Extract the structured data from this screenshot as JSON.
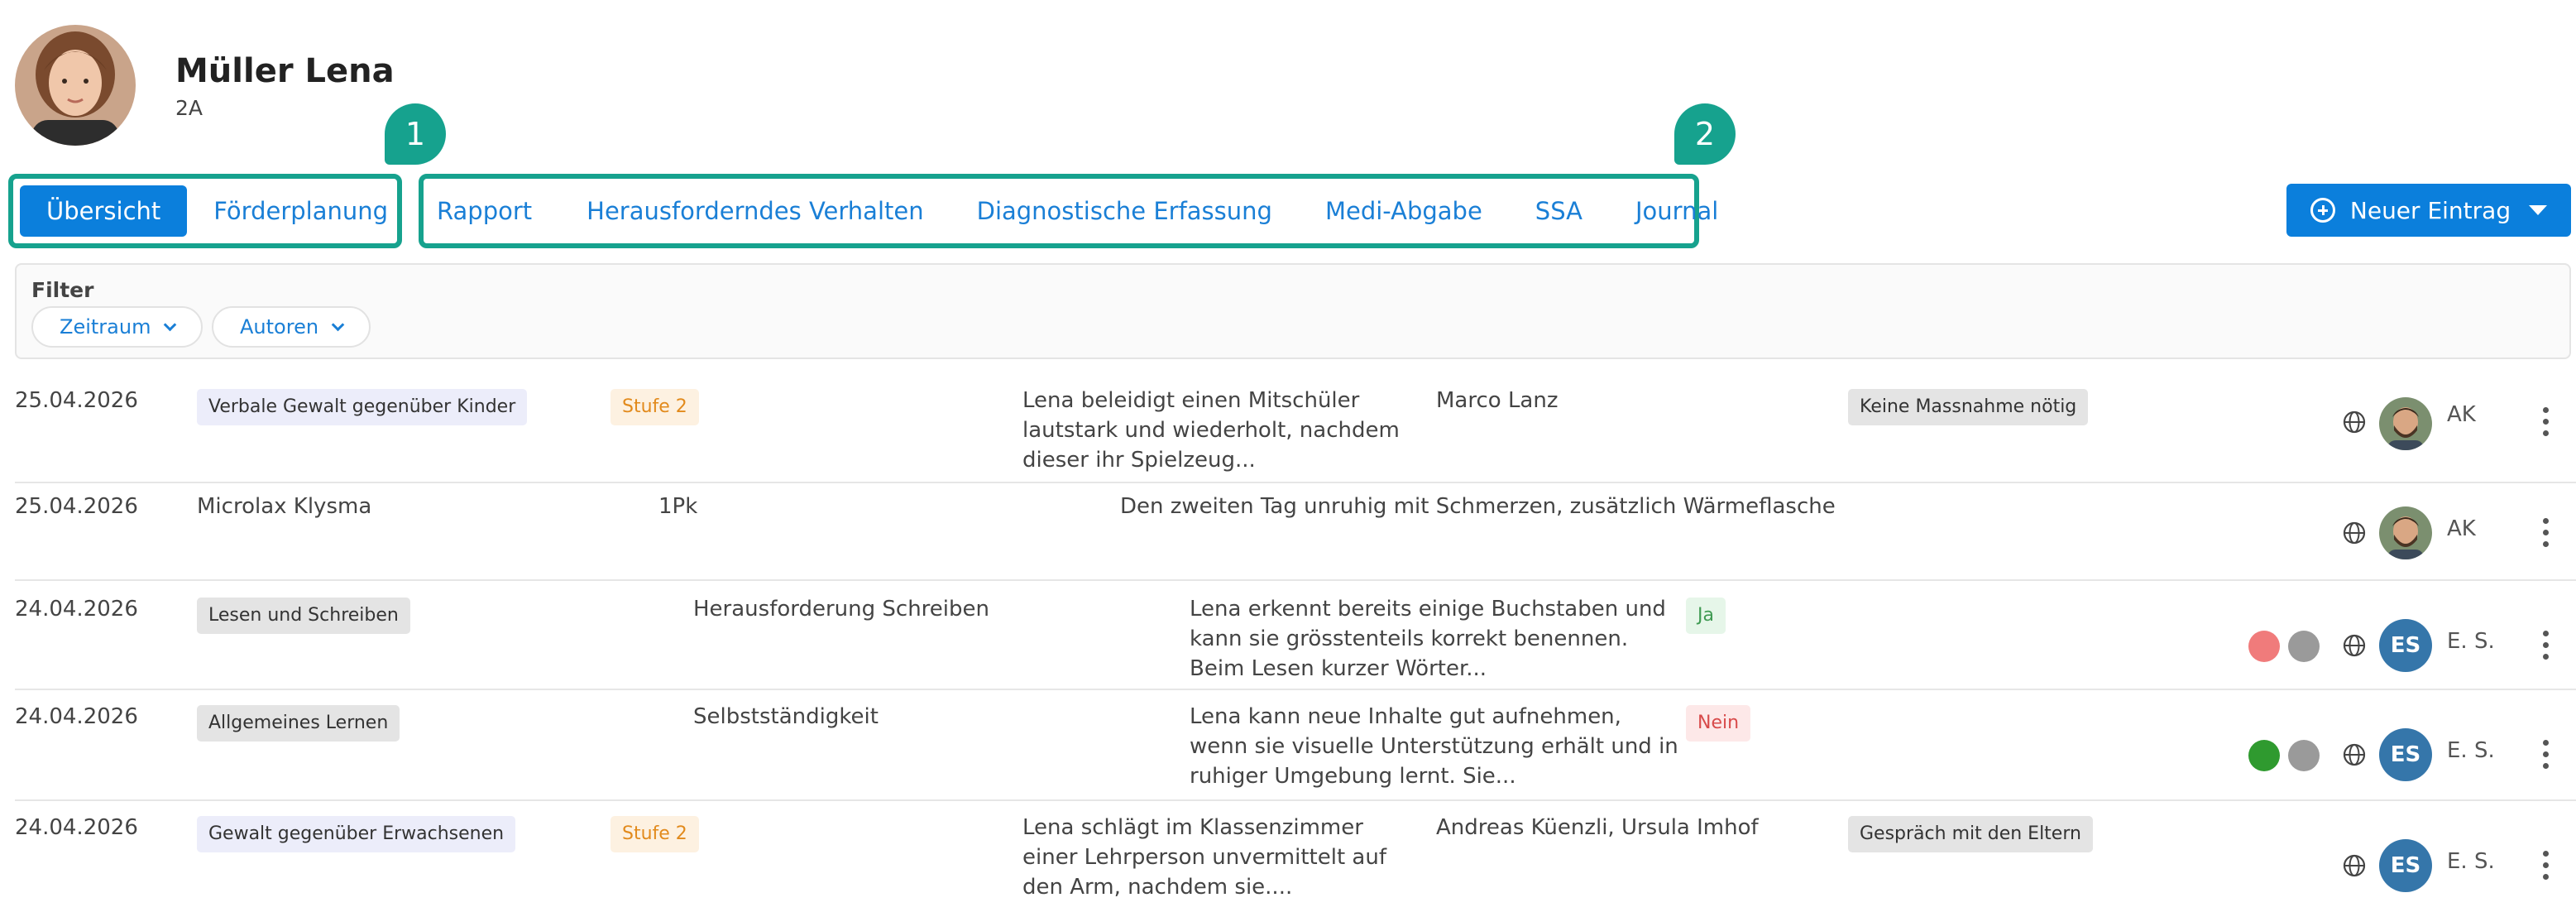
{
  "student": {
    "name": "Müller Lena",
    "class": "2A"
  },
  "markers": [
    "1",
    "2"
  ],
  "tabs_group1": [
    {
      "label": "Übersicht",
      "active": true
    },
    {
      "label": "Förderplanung",
      "active": false
    }
  ],
  "tabs_group2": [
    {
      "label": "Rapport"
    },
    {
      "label": "Herausforderndes Verhalten"
    },
    {
      "label": "Diagnostische Erfassung"
    },
    {
      "label": "Medi-Abgabe"
    },
    {
      "label": "SSA"
    },
    {
      "label": "Journal"
    }
  ],
  "new_entry_label": "Neuer Eintrag",
  "filter": {
    "label": "Filter",
    "chips": [
      "Zeitraum",
      "Autoren"
    ]
  },
  "rows": [
    {
      "date": "25.04.2026",
      "tag": "Verbale Gewalt gegenüber Kinder",
      "level": "Stufe 2",
      "description": "Lena beleidigt einen Mitschüler lautstark und wiederholt, nachdem dieser ihr Spielzeug...",
      "involved": "Marco Lanz",
      "action": "Keine Massnahme nötig",
      "author": "AK"
    },
    {
      "date": "25.04.2026",
      "medication": "Microlax Klysma",
      "dose": "1Pk",
      "note": "Den zweiten Tag unruhig mit Schmerzen, zusätzlich Wärmeflasche",
      "author": "AK"
    },
    {
      "date": "24.04.2026",
      "tag": "Lesen und Schreiben",
      "topic": "Herausforderung Schreiben",
      "description": "Lena erkennt bereits einige Buchstaben und kann sie grösstenteils korrekt benennen. Beim Lesen kurzer Wörter...",
      "status": "Ja",
      "author_initials": "ES",
      "author": "E. S.",
      "dot_colors": [
        "#f07b7b",
        "#9a9a9a"
      ]
    },
    {
      "date": "24.04.2026",
      "tag": "Allgemeines Lernen",
      "topic": "Selbstständigkeit",
      "description": "Lena kann neue Inhalte gut aufnehmen, wenn sie visuelle Unterstützung erhält und in ruhiger Umgebung lernt. Sie...",
      "status": "Nein",
      "author_initials": "ES",
      "author": "E. S.",
      "dot_colors": [
        "#2f9a2f",
        "#9a9a9a"
      ]
    },
    {
      "date": "24.04.2026",
      "tag": "Gewalt gegenüber Erwachsenen",
      "level": "Stufe 2",
      "description": "Lena schlägt im Klassenzimmer einer Lehrperson unvermittelt auf den Arm, nachdem sie....",
      "involved": "Andreas Küenzli, Ursula Imhof",
      "action": "Gespräch mit den Eltern",
      "author_initials": "ES",
      "author": "E. S."
    }
  ],
  "colors": {
    "accent": "#0b7fdc",
    "highlight": "#16a28e"
  }
}
